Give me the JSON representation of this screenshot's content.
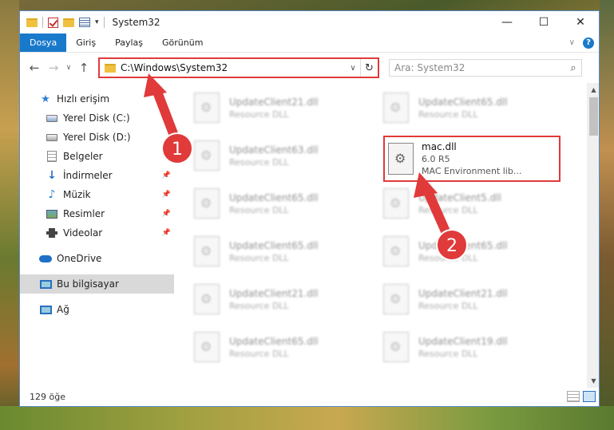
{
  "window": {
    "title": "System32"
  },
  "ribbon": {
    "tabs": [
      "Dosya",
      "Giriş",
      "Paylaş",
      "Görünüm"
    ],
    "help": "?"
  },
  "navigation": {
    "address": "C:\\Windows\\System32",
    "search_placeholder": "Ara: System32"
  },
  "sidebar": {
    "items": [
      {
        "label": "Hızlı erişim",
        "icon": "star-icon"
      },
      {
        "label": "Yerel Disk (C:)",
        "icon": "drive-icon"
      },
      {
        "label": "Yerel Disk (D:)",
        "icon": "drive-icon"
      },
      {
        "label": "Belgeler",
        "icon": "documents-icon"
      },
      {
        "label": "İndirmeler",
        "icon": "downloads-icon"
      },
      {
        "label": "Müzik",
        "icon": "music-icon"
      },
      {
        "label": "Resimler",
        "icon": "pictures-icon"
      },
      {
        "label": "Videolar",
        "icon": "videos-icon"
      },
      {
        "label": "OneDrive",
        "icon": "cloud-icon"
      },
      {
        "label": "Bu bilgisayar",
        "icon": "computer-icon"
      },
      {
        "label": "Ağ",
        "icon": "network-icon"
      }
    ]
  },
  "files": [
    {
      "name": "UpdateClient21.dll",
      "type": "Resource DLL"
    },
    {
      "name": "UpdateClient65.dll",
      "type": "Resource DLL"
    },
    {
      "name": "UpdateClient63.dll",
      "type": "Resource DLL"
    },
    {
      "name": "UpdateClient65.dll",
      "type": "Resource DLL"
    },
    {
      "name": "UpdateClient5.dll",
      "type": "Resource DLL"
    },
    {
      "name": "UpdateClient65.dll",
      "type": "Resource DLL"
    },
    {
      "name": "UpdateClient65.dll",
      "type": "Resource DLL"
    },
    {
      "name": "UpdateClient21.dll",
      "type": "Resource DLL"
    },
    {
      "name": "UpdateClient21.dll",
      "type": "Resource DLL"
    },
    {
      "name": "UpdateClient65.dll",
      "type": "Resource DLL"
    },
    {
      "name": "UpdateClient19.dll",
      "type": "Resource DLL"
    }
  ],
  "highlighted_file": {
    "name": "mac.dll",
    "version": "6.0 R5",
    "description": "MAC Environment lib..."
  },
  "annotations": {
    "step1": "1",
    "step2": "2",
    "accent": "#e03a3a"
  },
  "status": {
    "count": "129 öğe"
  }
}
